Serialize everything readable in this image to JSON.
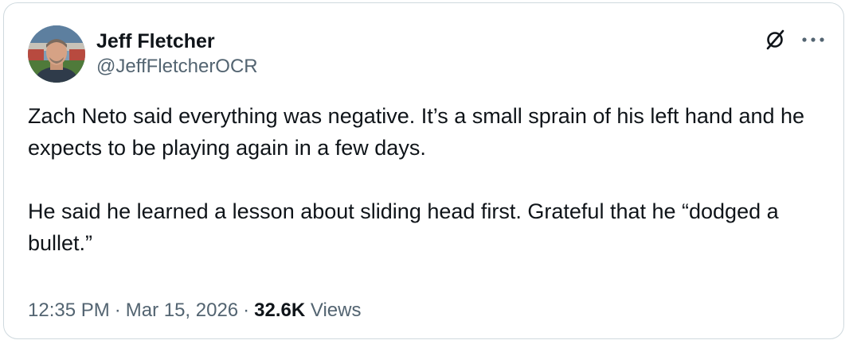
{
  "author": {
    "display_name": "Jeff Fletcher",
    "handle": "@JeffFletcherOCR",
    "avatar_icon": "user-avatar-photo"
  },
  "actions": {
    "grok_icon": "grok-slash-circle-icon",
    "more_icon": "more-horizontal-icon"
  },
  "tweet": {
    "paragraphs": [
      "Zach Neto said everything was negative. It’s a small sprain of his left hand and he expects to be playing again in a few days.",
      "He said he learned a lesson about sliding head first. Grateful that he “dodged a bullet.”"
    ]
  },
  "meta": {
    "time": "12:35 PM",
    "separator": "·",
    "date": "Mar 15, 2026",
    "views_count": "32.6K",
    "views_label": "Views"
  },
  "colors": {
    "text_primary": "#0f1419",
    "text_secondary": "#536471",
    "border": "#cfd9de"
  }
}
